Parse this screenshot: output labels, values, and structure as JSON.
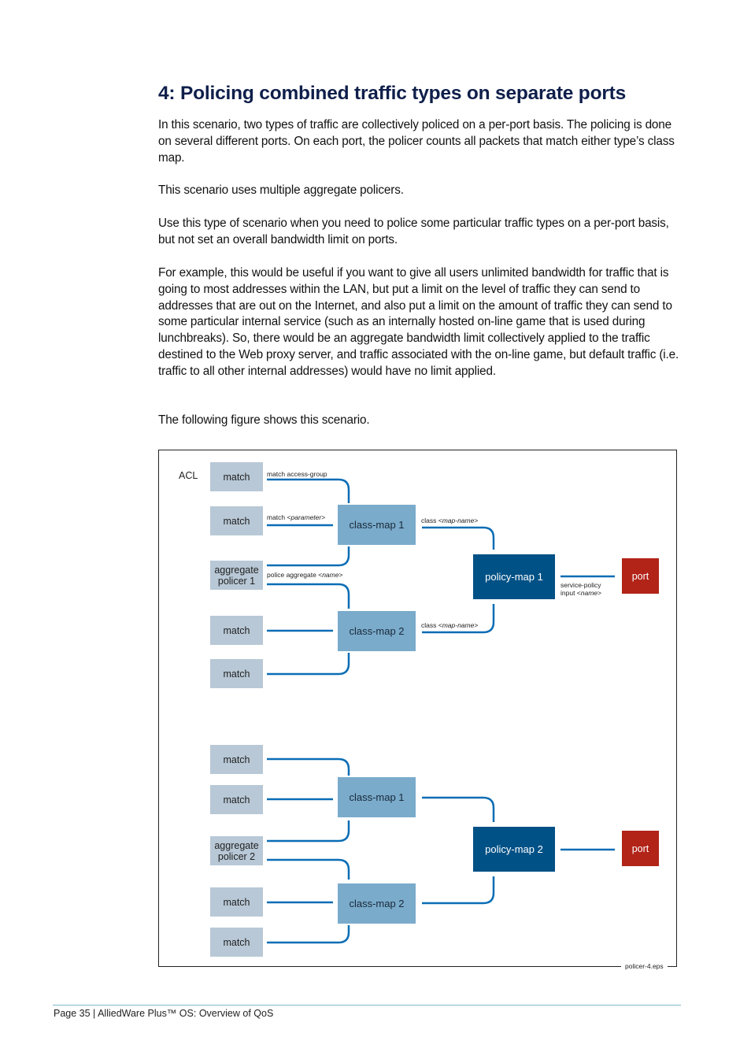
{
  "heading": "4: Policing combined traffic types on separate ports",
  "paragraphs": [
    "In this scenario, two types of traffic are collectively policed on a per-port basis. The policing is done on several different ports. On each port, the policer counts all packets that match either type’s class map.",
    "This scenario uses multiple aggregate policers.",
    "Use this type of scenario when you need to police some particular traffic types on a per-port basis, but not set an overall bandwidth limit on ports.",
    "For example, this would be useful if you want to give all users unlimited bandwidth for traffic that is going to most addresses within the LAN, but put a limit on the level of traffic they can send to addresses that are out on the Internet, and also put a limit on the amount of traffic they can send to some particular internal service (such as an internally hosted on-line game that is used during lunchbreaks). So, there would be an aggregate bandwidth limit collectively applied to the traffic destined to the Web proxy server, and traffic associated with the on-line game, but default traffic (i.e. traffic to all other internal addresses) would have no limit applied.",
    "The following figure shows this scenario."
  ],
  "figure": {
    "acl_label": "ACL",
    "filename": "policer-4.eps",
    "colors": {
      "match": "#b8c8d6",
      "class_map": "#7aabcb",
      "policy_map": "#005186",
      "port": "#b22318",
      "connector": "#0a6db5"
    },
    "connector_labels": {
      "match_access_group": "match access-group",
      "match_param_prefix": "match <",
      "match_param_italic": "parameter",
      "police_prefix": "police aggregate <",
      "police_italic": "name",
      "class_prefix": "class <",
      "class_italic": "map-name",
      "service_line1": "service-policy",
      "service_prefix": "input <",
      "service_italic": "name",
      "close": ">"
    },
    "group1": {
      "matches": [
        "match",
        "match",
        "match",
        "match"
      ],
      "aggregate_line1": "aggregate",
      "aggregate_line2": "policer 1",
      "class_map_1": "class-map 1",
      "class_map_2": "class-map 2",
      "policy_map": "policy-map 1",
      "port": "port"
    },
    "group2": {
      "matches": [
        "match",
        "match",
        "match",
        "match"
      ],
      "aggregate_line1": "aggregate",
      "aggregate_line2": "policer 2",
      "class_map_1": "class-map 1",
      "class_map_2": "class-map 2",
      "policy_map": "policy-map 2",
      "port": "port"
    }
  },
  "footer": "Page 35 | AlliedWare Plus™ OS: Overview of QoS"
}
